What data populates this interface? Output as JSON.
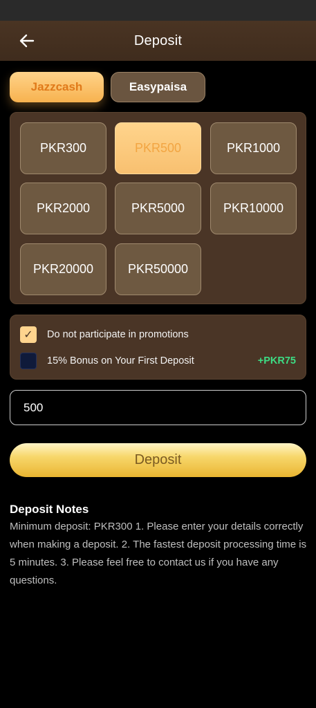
{
  "header": {
    "title": "Deposit",
    "back_icon": "arrow-left-icon"
  },
  "payment_methods": [
    {
      "label": "Jazzcash",
      "selected": true
    },
    {
      "label": "Easypaisa",
      "selected": false
    }
  ],
  "amounts": [
    {
      "label": "PKR300",
      "selected": false
    },
    {
      "label": "PKR500",
      "selected": true
    },
    {
      "label": "PKR1000",
      "selected": false
    },
    {
      "label": "PKR2000",
      "selected": false
    },
    {
      "label": "PKR5000",
      "selected": false
    },
    {
      "label": "PKR10000",
      "selected": false
    },
    {
      "label": "PKR20000",
      "selected": false
    },
    {
      "label": "PKR50000",
      "selected": false
    }
  ],
  "promotions": {
    "opt_out": {
      "label": "Do not participate in promotions",
      "checked": true
    },
    "first_deposit": {
      "label": "15% Bonus on Your First Deposit",
      "checked": false,
      "bonus": "+PKR75"
    }
  },
  "amount_input": {
    "value": "500"
  },
  "deposit_button": {
    "label": "Deposit"
  },
  "notes": {
    "title": "Deposit Notes",
    "body": "Minimum deposit: PKR300 1. Please enter your details correctly when making a deposit. 2. The fastest deposit processing time is 5 minutes. 3. Please feel free to contact us if you have any questions."
  },
  "colors": {
    "accent_gold": "#f7b24f",
    "panel_brown": "#4a3526",
    "bonus_green": "#3ddc84"
  }
}
